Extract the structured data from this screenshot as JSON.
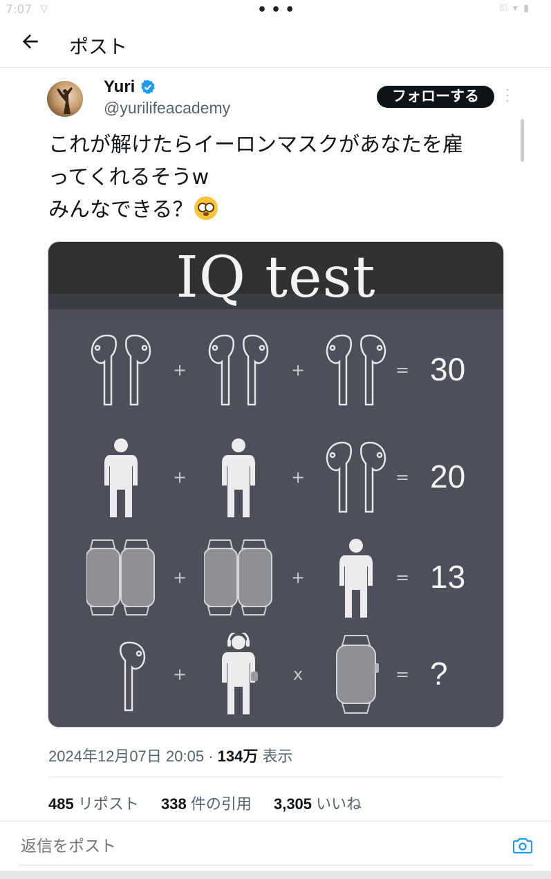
{
  "status_bar": {
    "time": "7:07"
  },
  "header": {
    "title": "ポスト"
  },
  "author": {
    "name": "Yuri",
    "handle": "@yurilifeacademy",
    "verified_color": "#1d9bf0"
  },
  "follow_button": {
    "label": "フォローする"
  },
  "tweet": {
    "lines": [
      "これが解けたらイーロンマスクがあなたを雇",
      "ってくれるそうw",
      "みんなできる？"
    ]
  },
  "media": {
    "title": "IQ test",
    "rows": [
      {
        "items": [
          "airpods-icon",
          "airpods-icon",
          "airpods-icon"
        ],
        "ops": [
          "+",
          "+",
          "="
        ],
        "result": "30"
      },
      {
        "items": [
          "person-icon",
          "person-icon",
          "airpods-icon"
        ],
        "ops": [
          "+",
          "+",
          "="
        ],
        "result": "20"
      },
      {
        "items": [
          "watch-pair-icon",
          "watch-pair-icon",
          "person-icon"
        ],
        "ops": [
          "+",
          "+",
          "="
        ],
        "result": "13"
      },
      {
        "items": [
          "single-airpod-icon",
          "person-with-headphones-icon",
          "watch-icon"
        ],
        "ops": [
          "+",
          "x",
          "="
        ],
        "result": "?"
      }
    ]
  },
  "meta": {
    "date": "2024年12月07日 20:05",
    "separator": "·",
    "views_count": "134万",
    "views_label": "表示"
  },
  "stats": {
    "reposts_count": "485",
    "reposts_label": "リポスト",
    "quotes_count": "338",
    "quotes_label": "件の引用",
    "likes_count": "3,305",
    "likes_label": "いいね"
  },
  "reply": {
    "placeholder": "返信をポスト"
  }
}
